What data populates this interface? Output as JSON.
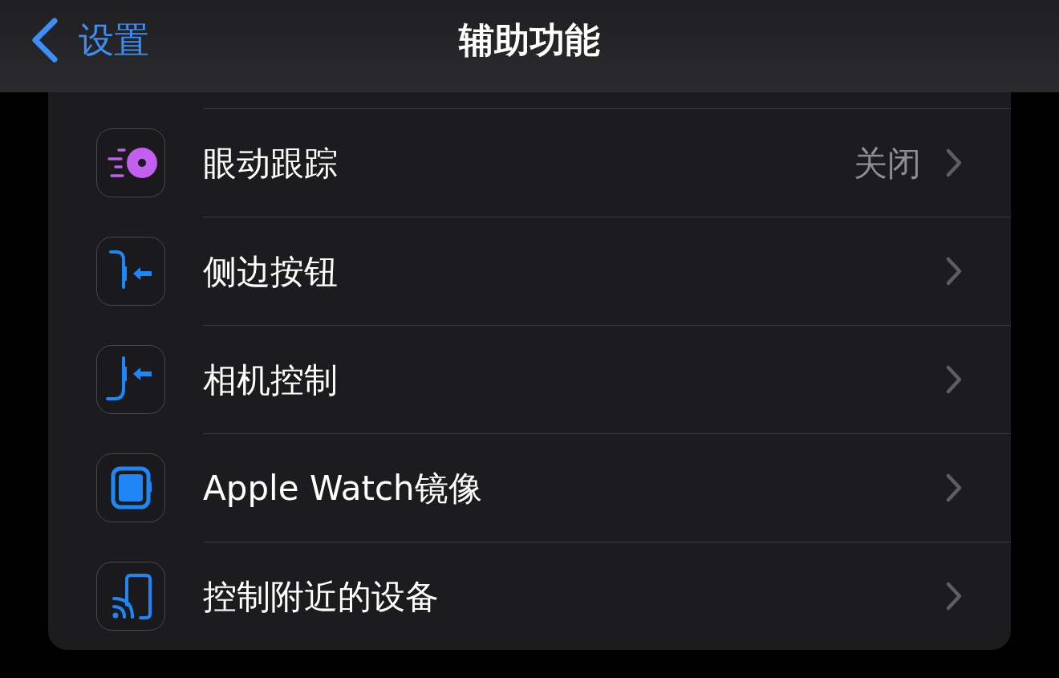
{
  "nav_bar": {
    "back_label": "设置",
    "title": "辅助功能"
  },
  "rows": [
    {
      "label": "眼动跟踪",
      "value": "关闭"
    },
    {
      "label": "侧边按钮"
    },
    {
      "label": "相机控制"
    },
    {
      "label": "Apple Watch镜像"
    },
    {
      "label": "控制附近的设备"
    }
  ]
}
